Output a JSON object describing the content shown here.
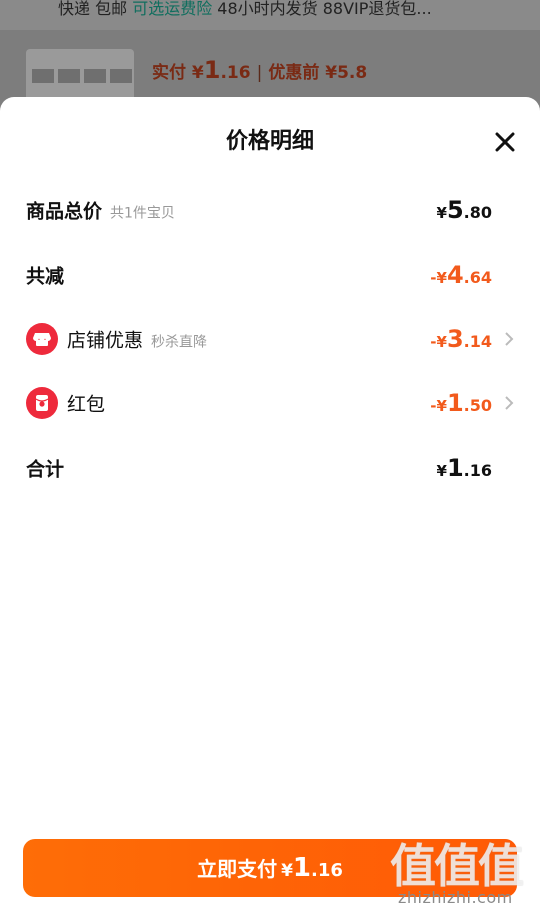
{
  "background": {
    "shipping_prefix": "快递 包邮 ",
    "shipping_link": "可选运费险",
    "shipping_suffix": " 48小时内发货 88VIP退货包...",
    "paid_label": "实付",
    "paid_currency": "¥",
    "paid_int": "1",
    "paid_dec": ".16",
    "before_discount": "优惠前 ¥5.8"
  },
  "sheet": {
    "title": "价格明细",
    "goods_total": {
      "label": "商品总价",
      "sub": "共1件宝贝",
      "currency": "¥",
      "int": "5",
      "dec": ".80"
    },
    "total_reduction": {
      "label": "共减",
      "currency": "-¥",
      "int": "4",
      "dec": ".64"
    },
    "store_discount": {
      "label": "店铺优惠",
      "sub": "秒杀直降",
      "currency": "-¥",
      "int": "3",
      "dec": ".14"
    },
    "red_packet": {
      "label": "红包",
      "currency": "-¥",
      "int": "1",
      "dec": ".50"
    },
    "sum": {
      "label": "合计",
      "currency": "¥",
      "int": "1",
      "dec": ".16"
    }
  },
  "pay_button": {
    "label": "立即支付",
    "currency": "¥",
    "int": "1",
    "dec": ".16"
  },
  "watermark": {
    "big": "值值值",
    "small": "zhizhizhi.com"
  },
  "colors": {
    "accent_orange": "#f25a1c",
    "button_orange": "#ff5a05",
    "icon_red": "#ee2a3c"
  },
  "icons": [
    "close-icon",
    "store-icon",
    "red-packet-icon",
    "chevron-right-icon"
  ]
}
